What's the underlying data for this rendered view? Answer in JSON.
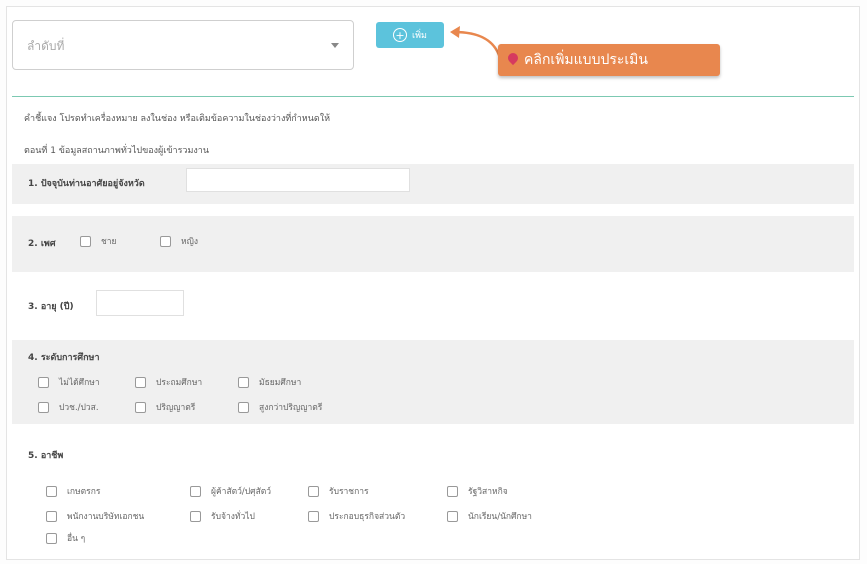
{
  "header": {
    "sequence_select": {
      "placeholder": "ลำดับที่"
    },
    "add_button": {
      "label": "เพิ่ม"
    },
    "callout": {
      "text": "คลิกเพิ่มแบบประเมิน"
    }
  },
  "form": {
    "instructions": "คำชี้แจง โปรดทำเครื่องหมาย ลงในช่อง หรือเติมข้อความในช่องว่างที่กำหนดให้",
    "section_title": "ตอนที่ 1 ข้อมูลสถานภาพทั่วไปของผู้เข้ารวมงาน",
    "q1": {
      "label": "1. ปัจจุบันท่านอาศัยอยู่จังหวัด"
    },
    "q2": {
      "label": "2. เพศ",
      "options": [
        "ชาย",
        "หญิง"
      ]
    },
    "q3": {
      "label": "3. อายุ (ปี)"
    },
    "q4": {
      "label": "4. ระดับการศึกษา",
      "options": [
        "ไม่ได้ศึกษา",
        "ประถมศึกษา",
        "มัธยมศึกษา",
        "ปวช./ปวส.",
        "ปริญญาตรี",
        "สูงกว่าปริญญาตรี"
      ]
    },
    "q5": {
      "label": "5. อาชีพ",
      "options": [
        "เกษตรกร",
        "ผู้ค้าสัตว์/ปศุสัตว์",
        "รับราชการ",
        "รัฐวิสาหกิจ",
        "พนักงานบริษัทเอกชน",
        "รับจ้างทั่วไป",
        "ประกอบธุรกิจส่วนตัว",
        "นักเรียน/นักศึกษา",
        "อื่น ๆ"
      ]
    }
  },
  "colors": {
    "accent": "#5cc3dc",
    "callout": "#e8874e",
    "divider": "#7cc9b2"
  },
  "icons": {
    "add": "plus-circle-icon",
    "callout_pin": "pin-icon",
    "select_caret": "chevron-down-icon"
  }
}
